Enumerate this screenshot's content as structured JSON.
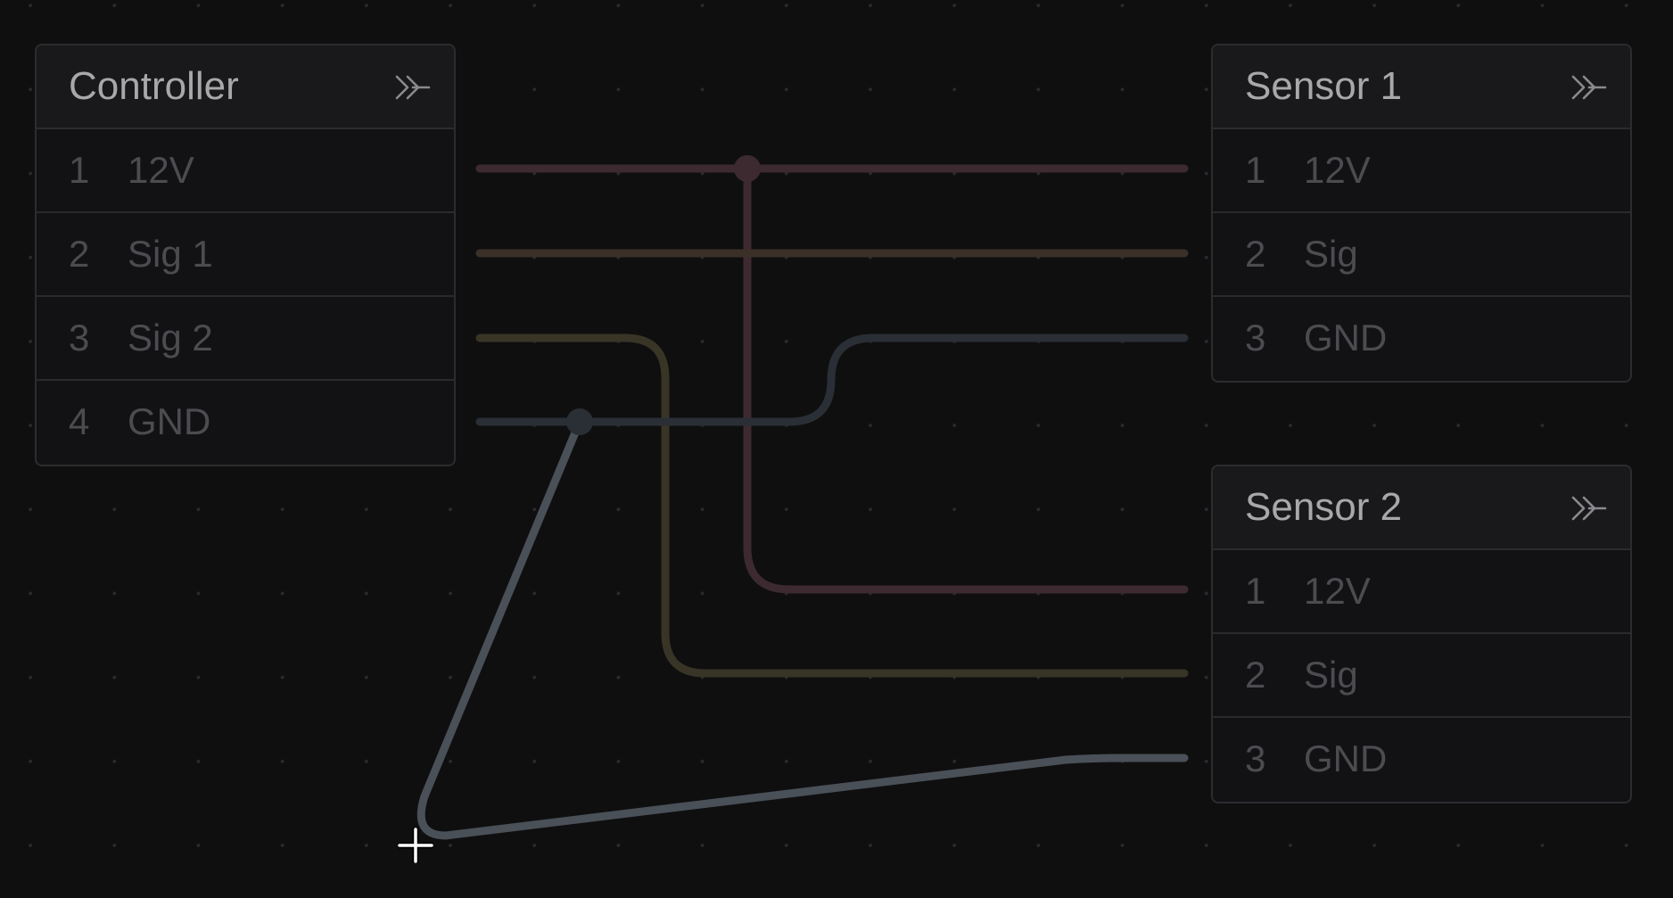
{
  "nodes": [
    {
      "id": "controller",
      "title": "Controller",
      "action_icon": "double-chevron-right-icon",
      "pins": [
        {
          "num": "1",
          "label": "12V"
        },
        {
          "num": "2",
          "label": "Sig 1"
        },
        {
          "num": "3",
          "label": "Sig 2"
        },
        {
          "num": "4",
          "label": "GND"
        }
      ]
    },
    {
      "id": "sensor-1",
      "title": "Sensor 1",
      "action_icon": "double-chevron-right-icon",
      "pins": [
        {
          "num": "1",
          "label": "12V"
        },
        {
          "num": "2",
          "label": "Sig"
        },
        {
          "num": "3",
          "label": "GND"
        }
      ]
    },
    {
      "id": "sensor-2",
      "title": "Sensor 2",
      "action_icon": "double-chevron-right-icon",
      "pins": [
        {
          "num": "1",
          "label": "12V"
        },
        {
          "num": "2",
          "label": "Sig"
        },
        {
          "num": "3",
          "label": "GND"
        }
      ]
    }
  ],
  "wires": [
    {
      "from": "Controller.12V",
      "to": "Sensor 1.12V",
      "color": "#3d2a30"
    },
    {
      "from": "Controller.12V",
      "to": "Sensor 2.12V",
      "color": "#3d2a30"
    },
    {
      "from": "Controller.Sig 1",
      "to": "Sensor 1.Sig",
      "color": "#3a3027"
    },
    {
      "from": "Controller.Sig 2",
      "to": "Sensor 2.Sig",
      "color": "#383526"
    },
    {
      "from": "Controller.GND",
      "to": "Sensor 1.GND",
      "color": "#2a2e35"
    },
    {
      "from": "Controller.GND",
      "to": "Sensor 2.GND",
      "color": "#4a5058",
      "state": "being dragged"
    }
  ],
  "cursor_icon": "crosshair-plus-icon",
  "colors": {
    "background": "#0f0f10",
    "grid_dot": "#2b2b2e",
    "node_bg": "#121214",
    "node_header_bg": "#19191b",
    "node_border": "#2c2c2f",
    "title_text": "#a8a8ab",
    "pin_text": "#4c4c50"
  }
}
